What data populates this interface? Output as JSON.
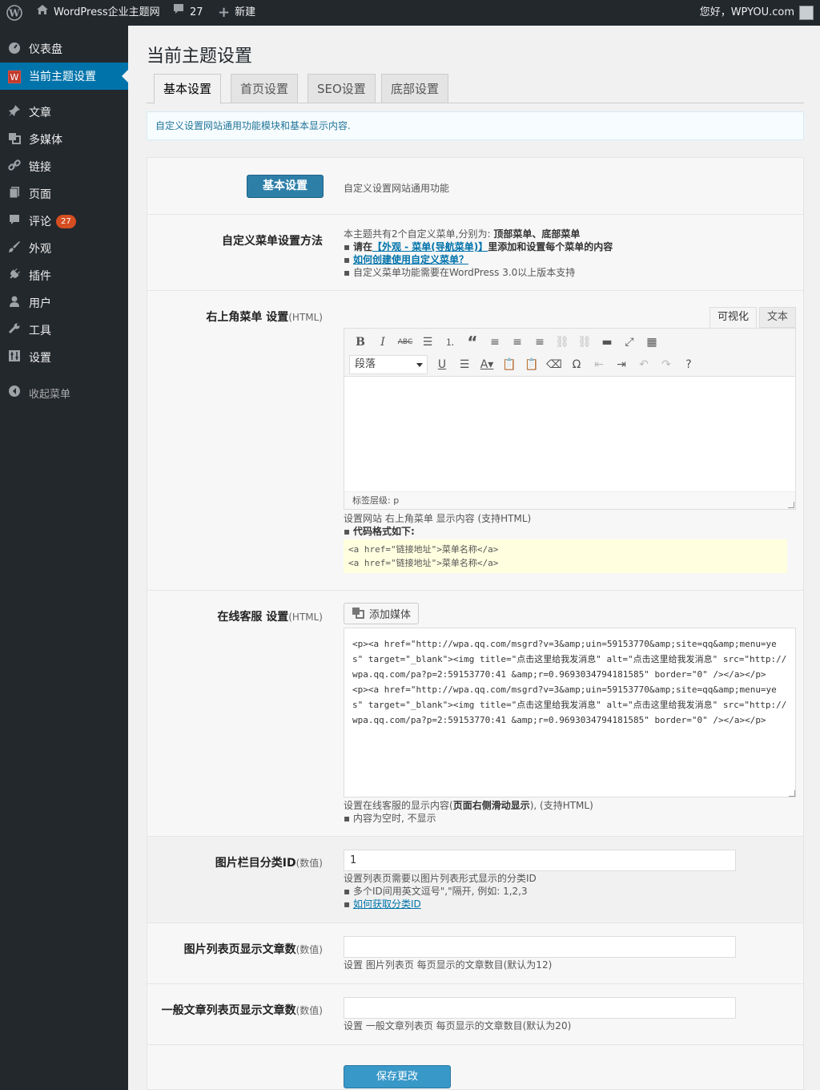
{
  "adminbar": {
    "wp_icon": "wordpress-logo-icon",
    "site_name": "WordPress企业主题网",
    "comments_count": "27",
    "new_label": "新建",
    "greeting": "您好，",
    "username": "WPYOU.com"
  },
  "sidebar": {
    "items": [
      {
        "label": "仪表盘",
        "icon": "dashboard-icon"
      },
      {
        "label": "当前主题设置",
        "icon": "theme-w-icon"
      },
      {
        "label": "文章",
        "icon": "pin-icon"
      },
      {
        "label": "多媒体",
        "icon": "media-icon"
      },
      {
        "label": "链接",
        "icon": "link-icon"
      },
      {
        "label": "页面",
        "icon": "page-icon"
      },
      {
        "label": "评论",
        "icon": "comment-icon",
        "badge": "27"
      },
      {
        "label": "外观",
        "icon": "brush-icon"
      },
      {
        "label": "插件",
        "icon": "plugin-icon"
      },
      {
        "label": "用户",
        "icon": "user-icon"
      },
      {
        "label": "工具",
        "icon": "wrench-icon"
      },
      {
        "label": "设置",
        "icon": "settings-icon"
      }
    ],
    "collapse_label": "收起菜单"
  },
  "page": {
    "title": "当前主题设置",
    "tabs": [
      "基本设置",
      "首页设置",
      "SEO设置",
      "底部设置"
    ],
    "notice": "自定义设置网站通用功能模块和基本显示内容."
  },
  "section_header": {
    "button": "基本设置",
    "desc": "自定义设置网站通用功能"
  },
  "menu_method": {
    "label": "自定义菜单设置方法",
    "line1_text": "本主题共有2个自定义菜单,分别为: ",
    "line1_bold": "顶部菜单、底部菜单",
    "line2_pre": "请在",
    "line2_link": "【外观 - 菜单(导航菜单)】",
    "line2_post": "里添加和设置每个菜单的内容",
    "line3_link": "如何创建使用自定义菜单？",
    "line4": "自定义菜单功能需要在WordPress 3.0以上版本支持"
  },
  "top_menu": {
    "label": "右上角菜单 设置",
    "label_small": "(HTML)",
    "tab_visual": "可视化",
    "tab_text": "文本",
    "format_select": "段落",
    "status_path": "标签层级: p",
    "desc1": "设置网站 右上角菜单 显示内容 (支持HTML)",
    "desc2": "代码格式如下:",
    "code_lines": [
      "<a href=\"链接地址\">菜单名称</a>",
      "<a href=\"链接地址\">菜单名称</a>"
    ]
  },
  "online_service": {
    "label": "在线客服 设置",
    "label_small": "(HTML)",
    "media_button": "添加媒体",
    "content": "<p><a href=\"http://wpa.qq.com/msgrd?v=3&amp;uin=59153770&amp;site=qq&amp;menu=yes\" target=\"_blank\"><img title=\"点击这里给我发消息\" alt=\"点击这里给我发消息\" src=\"http://wpa.qq.com/pa?p=2:59153770:41 &amp;r=0.9693034794181585\" border=\"0\" /></a></p>\n<p><a href=\"http://wpa.qq.com/msgrd?v=3&amp;uin=59153770&amp;site=qq&amp;menu=yes\" target=\"_blank\"><img title=\"点击这里给我发消息\" alt=\"点击这里给我发消息\" src=\"http://wpa.qq.com/pa?p=2:59153770:41 &amp;r=0.9693034794181585\" border=\"0\" /></a></p>",
    "desc1_pre": "设置在线客服的显示内容(",
    "desc1_bold": "页面右侧滑动显示",
    "desc1_post": "), (支持HTML)",
    "desc2": "内容为空时, 不显示"
  },
  "image_cat": {
    "label": "图片栏目分类ID",
    "label_small": "(数值)",
    "value": "1",
    "desc1": "设置列表页需要以图片列表形式显示的分类ID",
    "desc2": "多个ID间用英文逗号\",\"隔开, 例如: 1,2,3",
    "desc3": "如何获取分类ID"
  },
  "image_list_count": {
    "label": "图片列表页显示文章数",
    "label_small": "(数值)",
    "value": "",
    "desc": "设置 图片列表页 每页显示的文章数目(默认为12)"
  },
  "post_list_count": {
    "label": "一般文章列表页显示文章数",
    "label_small": "(数值)",
    "value": "",
    "desc": "设置 一般文章列表页 每页显示的文章数目(默认为20)"
  },
  "save_button": "保存更改",
  "colors": {
    "adminbar_bg": "#23282d",
    "accent": "#0073aa",
    "badge": "#d54e21",
    "primary_button": "#2e7fa8"
  }
}
